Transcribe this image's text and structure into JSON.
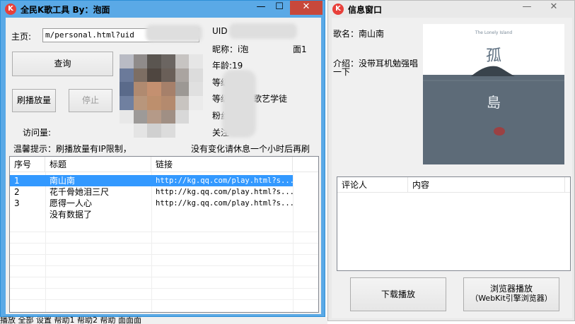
{
  "main_window": {
    "title": "全民K歌工具 By：泡面",
    "icon": "k-song-logo-icon",
    "buttons": {
      "minimize": "—",
      "maximize": "☐",
      "close": "✕"
    },
    "homepage_label": "主页:",
    "homepage_value": "m/personal.html?uid",
    "query_button": "查询",
    "brush_button": "刷播放量",
    "stop_button": "停止",
    "visits_label": "访问量:",
    "uid_label": "UID",
    "nickname_label": "昵称：i泡",
    "nickname_tail": "面1",
    "age_label": "年龄:19",
    "level_label": "等级:",
    "level2_label": "等级:",
    "level2_value": "歌艺学徒",
    "fans_label": "粉丝",
    "follow_label": "关注",
    "tip_prefix": "温馨提示：刷播放量有IP限制，",
    "tip_suffix": "没有变化请休息一个小时后再刷",
    "table": {
      "headers": [
        "序号",
        "标题",
        "链接"
      ],
      "rows": [
        {
          "num": "1",
          "title": "南山南",
          "link": "http://kg.qq.com/play.html?s..."
        },
        {
          "num": "2",
          "title": "花千骨她泪三尺",
          "link": "http://kg.qq.com/play.html?s..."
        },
        {
          "num": "3",
          "title": "愿得一人心",
          "link": "http://kg.qq.com/play.html?s..."
        },
        {
          "num": "",
          "title": "没有数据了",
          "link": ""
        }
      ]
    }
  },
  "info_window": {
    "title": "信息窗口",
    "icon": "k-song-logo-icon",
    "buttons": {
      "minimize": "—",
      "close": "✕"
    },
    "song_name": "歌名：南山南",
    "intro_line1": "介绍：没带耳机勉强唱",
    "intro_line2": "一下",
    "cover": {
      "small_text": "The Lonely Island",
      "char1": "孤",
      "char2": "島"
    },
    "comments_headers": [
      "评论人",
      "内容"
    ],
    "download_button": "下载播放",
    "browser_button_line1": "浏览器播放",
    "browser_button_line2": "（WebKit引擎浏览器）"
  },
  "taskbar_text": "播放   全部   设置   帮助1   帮助2   帮助   面面面"
}
